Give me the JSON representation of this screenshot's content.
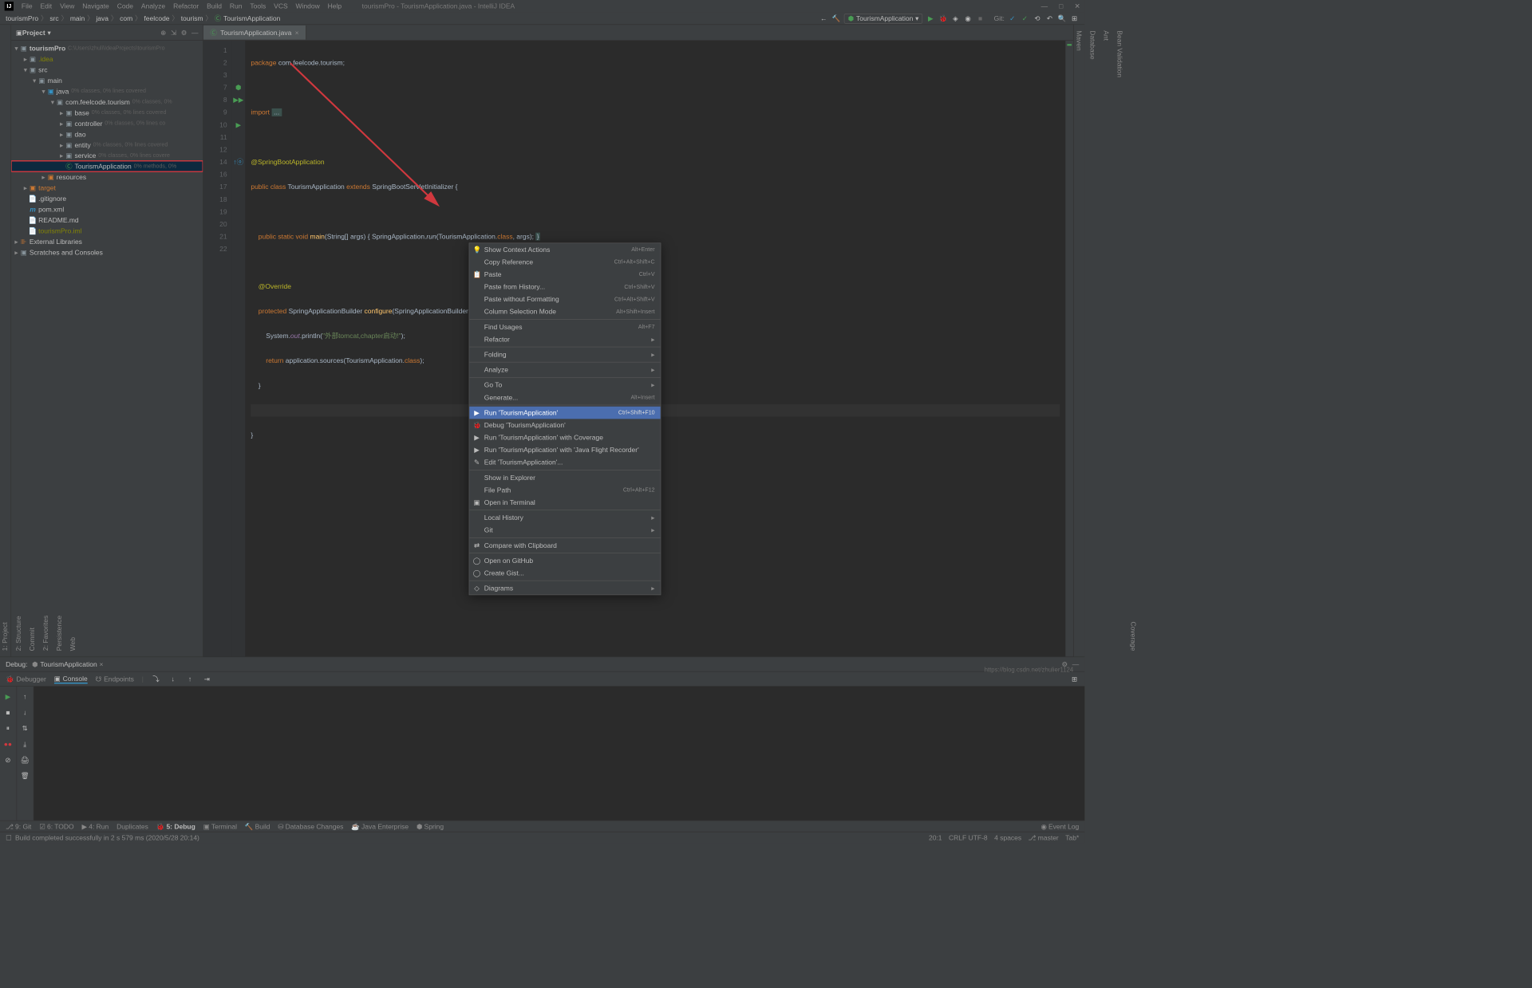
{
  "window_title": "tourismPro - TourismApplication.java - IntelliJ IDEA",
  "menu": [
    "File",
    "Edit",
    "View",
    "Navigate",
    "Code",
    "Analyze",
    "Refactor",
    "Build",
    "Run",
    "Tools",
    "VCS",
    "Window",
    "Help"
  ],
  "breadcrumb": [
    "tourismPro",
    "src",
    "main",
    "java",
    "com",
    "feelcode",
    "tourism",
    "TourismApplication"
  ],
  "run_config": "TourismApplication",
  "git_label": "Git:",
  "project_panel": {
    "title": "Project"
  },
  "editor_tab": "TourismApplication.java",
  "tree": {
    "root": "tourismPro",
    "root_hint": "C:\\Users\\zhuli\\IdeaProjects\\tourismPro",
    "idea": ".idea",
    "src": "src",
    "main": "main",
    "java": "java",
    "java_hint": "0% classes, 0% lines covered",
    "pkg": "com.feelcode.tourism",
    "pkg_hint": "0% classes, 0%",
    "base": "base",
    "base_hint": "0% classes, 0% lines covered",
    "controller": "controller",
    "controller_hint": "0% classes, 0% lines co",
    "dao": "dao",
    "entity": "entity",
    "entity_hint": "0% classes, 0% lines covered",
    "service": "service",
    "service_hint": "0% classes, 0% lines covere",
    "app": "TourismApplication",
    "app_hint": "0% methods, 0%",
    "resources": "resources",
    "target": "target",
    "gitignore": ".gitignore",
    "pom": "pom.xml",
    "readme": "README.md",
    "iml": "tourismPro.iml",
    "ext": "External Libraries",
    "scratch": "Scratches and Consoles"
  },
  "code": {
    "l1_kw": "package ",
    "l1_pkg": "com.feelcode.tourism",
    "l1_end": ";",
    "l3_kw": "import ",
    "l3_rest": "...",
    "l5": "@SpringBootApplication",
    "l6_a": "public class ",
    "l6_b": "TourismApplication ",
    "l6_c": "extends ",
    "l6_d": "SpringBootServletInitializer {",
    "l8_a": "    public static void ",
    "l8_b": "main",
    "l8_c": "(String[] args) ",
    "l8_d": "{ ",
    "l8_e": "SpringApplication.",
    "l8_f": "run",
    "l8_g": "(TourismApplication.",
    "l8_h": "class",
    "l8_i": ", args); ",
    "l8_j": "}",
    "l10": "    @Override",
    "l11_a": "    protected ",
    "l11_b": "SpringApplicationBuilder ",
    "l11_c": "configure",
    "l11_d": "(SpringApplicationBuilder application){",
    "l12_a": "        System.",
    "l12_b": "out",
    "l12_c": ".println(",
    "l12_d": "\"外部tomcat,chapter启动!\"",
    "l12_e": ");",
    "l13_a": "        return ",
    "l13_b": "application.sources(TourismApplication.",
    "l13_c": "class",
    "l13_d": ");",
    "l14": "    }",
    "l16": "}"
  },
  "line_numbers": [
    "1",
    "2",
    "3",
    "7",
    "8",
    "9",
    "10",
    "11",
    "12",
    "14",
    "16",
    "17",
    "18",
    "19",
    "20",
    "21",
    "22"
  ],
  "context_menu": [
    {
      "label": "Show Context Actions",
      "shortcut": "Alt+Enter",
      "icon": "💡"
    },
    {
      "label": "Copy Reference",
      "shortcut": "Ctrl+Alt+Shift+C"
    },
    {
      "label": "Paste",
      "shortcut": "Ctrl+V",
      "icon": "📋"
    },
    {
      "label": "Paste from History...",
      "shortcut": "Ctrl+Shift+V"
    },
    {
      "label": "Paste without Formatting",
      "shortcut": "Ctrl+Alt+Shift+V"
    },
    {
      "label": "Column Selection Mode",
      "shortcut": "Alt+Shift+Insert"
    },
    {
      "sep": true
    },
    {
      "label": "Find Usages",
      "shortcut": "Alt+F7"
    },
    {
      "label": "Refactor",
      "sub": true
    },
    {
      "sep": true
    },
    {
      "label": "Folding",
      "sub": true
    },
    {
      "sep": true
    },
    {
      "label": "Analyze",
      "sub": true
    },
    {
      "sep": true
    },
    {
      "label": "Go To",
      "sub": true
    },
    {
      "label": "Generate...",
      "shortcut": "Alt+Insert"
    },
    {
      "sep": true
    },
    {
      "label": "Run 'TourismApplication'",
      "shortcut": "Ctrl+Shift+F10",
      "icon": "▶",
      "selected": true
    },
    {
      "label": "Debug 'TourismApplication'",
      "icon": "🐞"
    },
    {
      "label": "Run 'TourismApplication' with Coverage",
      "icon": "▶"
    },
    {
      "label": "Run 'TourismApplication' with 'Java Flight Recorder'",
      "icon": "▶"
    },
    {
      "label": "Edit 'TourismApplication'...",
      "icon": "✎"
    },
    {
      "sep": true
    },
    {
      "label": "Show in Explorer"
    },
    {
      "label": "File Path",
      "shortcut": "Ctrl+Alt+F12"
    },
    {
      "label": "Open in Terminal",
      "icon": "▣"
    },
    {
      "sep": true
    },
    {
      "label": "Local History",
      "sub": true
    },
    {
      "label": "Git",
      "sub": true
    },
    {
      "sep": true
    },
    {
      "label": "Compare with Clipboard",
      "icon": "⇄"
    },
    {
      "sep": true
    },
    {
      "label": "Open on GitHub",
      "icon": "◯"
    },
    {
      "label": "Create Gist...",
      "icon": "◯"
    },
    {
      "sep": true
    },
    {
      "label": "Diagrams",
      "sub": true,
      "icon": "◇"
    }
  ],
  "debug": {
    "label": "Debug:",
    "config": "TourismApplication",
    "tabs": [
      "Debugger",
      "Console",
      "Endpoints"
    ]
  },
  "bottom_tabs": [
    "9: Git",
    "6: TODO",
    "4: Run",
    "Duplicates",
    "5: Debug",
    "Terminal",
    "Build",
    "Database Changes",
    "Java Enterprise",
    "Spring"
  ],
  "status": {
    "build": "Build completed successfully in 2 s 579 ms (2020/5/28 20:14)",
    "pos": "20:1",
    "encoding": "CRLF   UTF-8",
    "spaces": "4 spaces",
    "branch": "master",
    "tab": "Tab*",
    "event_log": "Event Log"
  },
  "left_tabs": [
    "1: Project",
    "2: Structure",
    "Commit",
    "2: Favorites",
    "Persistence",
    "Web"
  ],
  "right_tabs": [
    "Maven",
    "Database",
    "Ant",
    "Bean Validation",
    "Coverage"
  ],
  "watermark": "https://blog.csdn.net/zhulier1124"
}
